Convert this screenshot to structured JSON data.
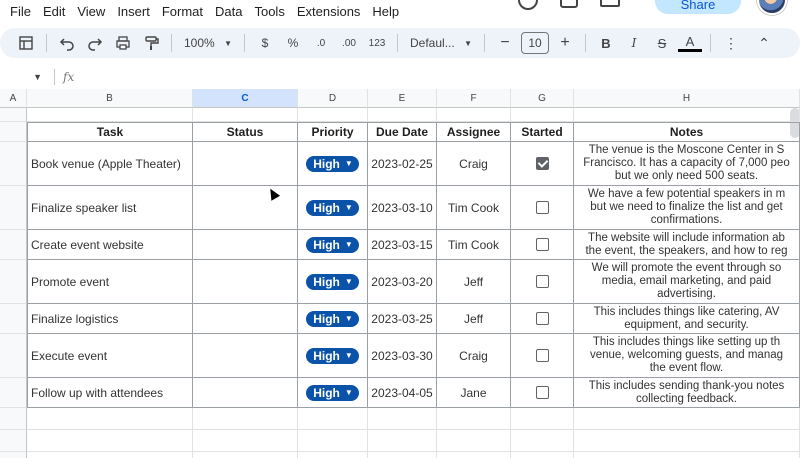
{
  "menu": [
    "File",
    "Edit",
    "View",
    "Insert",
    "Format",
    "Data",
    "Tools",
    "Extensions",
    "Help"
  ],
  "share_label": "Share",
  "toolbar": {
    "zoom": "100%",
    "currency": "$",
    "percent": "%",
    "dec_decrease": ".0",
    "dec_increase": ".00",
    "number_format": "123",
    "font": "Defaul...",
    "font_size": "10",
    "bold": "B",
    "italic": "I",
    "strike": "S",
    "text_color": "A",
    "more": "⋮",
    "collapse": "⌃"
  },
  "formula_bar": {
    "fx": "fx",
    "value": ""
  },
  "columns": [
    "A",
    "B",
    "C",
    "D",
    "E",
    "F",
    "G",
    "H"
  ],
  "headers": {
    "task": "Task",
    "status": "Status",
    "priority": "Priority",
    "due": "Due Date",
    "assignee": "Assignee",
    "started": "Started",
    "notes": "Notes"
  },
  "rows": [
    {
      "task": "Book venue (Apple Theater)",
      "status": "",
      "priority": "High",
      "due": "2023-02-25",
      "assignee": "Craig",
      "started": true,
      "notes": [
        "The venue is the Moscone Center in S",
        "Francisco. It has a capacity of 7,000 peo",
        "but we only need 500 seats."
      ]
    },
    {
      "task": "Finalize speaker list",
      "status": "",
      "priority": "High",
      "due": "2023-03-10",
      "assignee": "Tim Cook",
      "started": false,
      "notes": [
        "We have a few potential speakers in m",
        "but we need to finalize the list and get",
        "confirmations."
      ]
    },
    {
      "task": "Create event website",
      "status": "",
      "priority": "High",
      "due": "2023-03-15",
      "assignee": "Tim Cook",
      "started": false,
      "notes": [
        "The website will include information ab",
        "the event, the speakers, and how to reg"
      ]
    },
    {
      "task": "Promote event",
      "status": "",
      "priority": "High",
      "due": "2023-03-20",
      "assignee": "Jeff",
      "started": false,
      "notes": [
        "We will promote the event through so",
        "media, email marketing, and paid",
        "advertising."
      ]
    },
    {
      "task": "Finalize logistics",
      "status": "",
      "priority": "High",
      "due": "2023-03-25",
      "assignee": "Jeff",
      "started": false,
      "notes": [
        "This includes things like catering, AV",
        "equipment, and security."
      ]
    },
    {
      "task": "Execute event",
      "status": "",
      "priority": "High",
      "due": "2023-03-30",
      "assignee": "Craig",
      "started": false,
      "notes": [
        "This includes things like setting up th",
        "venue, welcoming guests, and manag",
        "the event flow."
      ]
    },
    {
      "task": "Follow up with attendees",
      "status": "",
      "priority": "High",
      "due": "2023-04-05",
      "assignee": "Jane",
      "started": false,
      "notes": [
        "This includes sending thank-you notes",
        "collecting feedback."
      ]
    }
  ],
  "colors": {
    "chip": "#0a53a8",
    "selected_col": "#d3e3fd",
    "toolbar_bg": "#eef2f9"
  }
}
